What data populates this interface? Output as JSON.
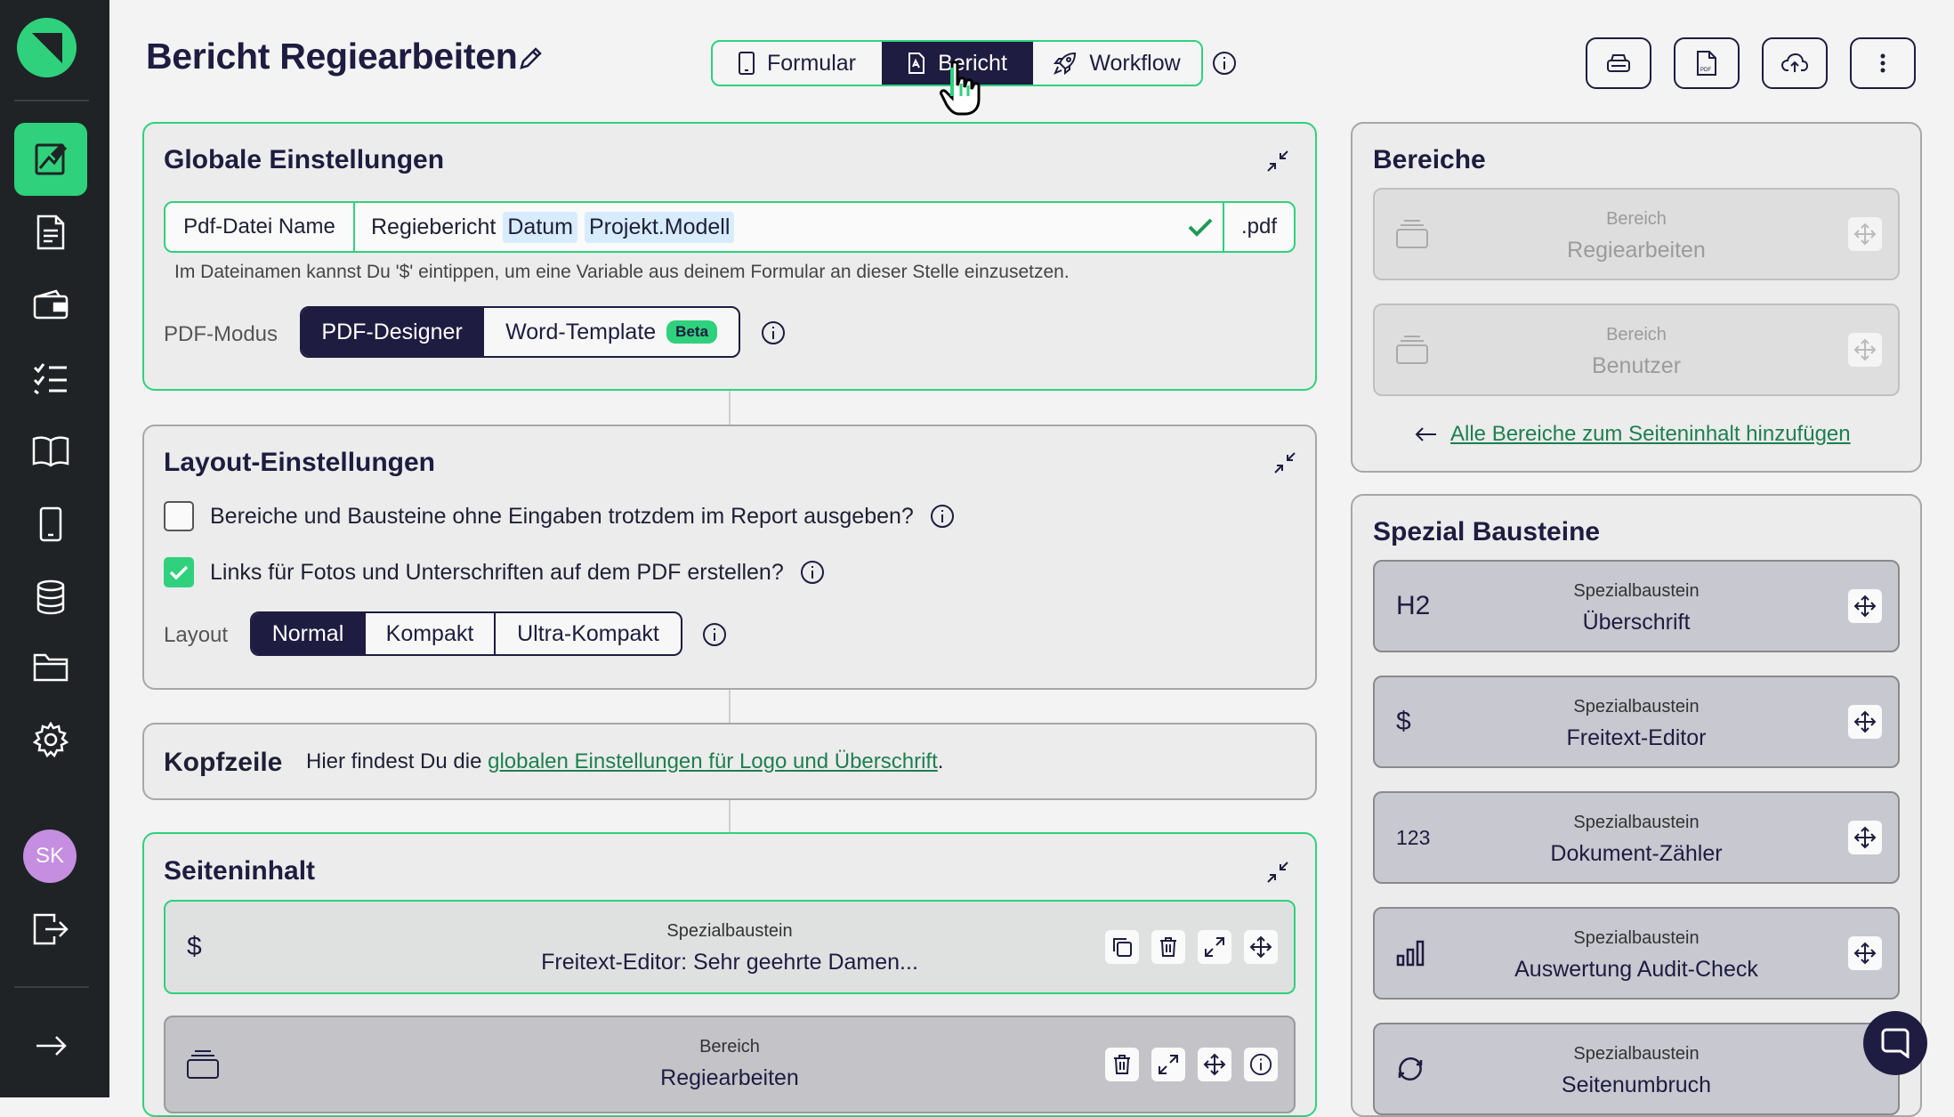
{
  "page": {
    "title": "Bericht Regiearbeiten"
  },
  "user": {
    "initials": "SK"
  },
  "sidebar": {
    "items": [
      {
        "icon": "report-designer-icon",
        "active": true
      },
      {
        "icon": "document-icon"
      },
      {
        "icon": "wallet-icon"
      },
      {
        "icon": "checklist-icon"
      },
      {
        "icon": "book-icon"
      },
      {
        "icon": "mobile-icon"
      },
      {
        "icon": "database-icon"
      },
      {
        "icon": "folder-icon"
      },
      {
        "icon": "settings-icon"
      }
    ],
    "logout_icon": "logout-icon",
    "expand_icon": "arrow-right-icon"
  },
  "top_tabs": [
    {
      "label": "Formular",
      "icon": "mobile-icon"
    },
    {
      "label": "Bericht",
      "icon": "pdf-icon",
      "active": true
    },
    {
      "label": "Workflow",
      "icon": "rocket-icon"
    }
  ],
  "toolbar_icons": [
    "printer-icon",
    "pdf-file-icon",
    "cloud-upload-icon",
    "more-vertical-icon"
  ],
  "global": {
    "title": "Globale Einstellungen",
    "filename_label": "Pdf-Datei Name",
    "filename_text": "Regiebericht",
    "filename_chips": [
      "Datum",
      "Projekt.Modell"
    ],
    "filename_suffix": ".pdf",
    "hint": "Im Dateinamen kannst Du '$' eintippen, um eine Variable aus deinem Formular an dieser Stelle einzusetzen.",
    "pdf_mode_label": "PDF-Modus",
    "pdf_modes": [
      "PDF-Designer",
      "Word-Template"
    ],
    "pdf_mode_selected": "PDF-Designer",
    "beta_badge": "Beta"
  },
  "layout": {
    "title": "Layout-Einstellungen",
    "checkbox_1": {
      "label": "Bereiche und Bausteine ohne Eingaben trotzdem im Report ausgeben?",
      "checked": false
    },
    "checkbox_2": {
      "label": "Links für Fotos und Unterschriften auf dem PDF erstellen?",
      "checked": true
    },
    "layout_label": "Layout",
    "options": [
      "Normal",
      "Kompakt",
      "Ultra-Kompakt"
    ],
    "selected": "Normal"
  },
  "header": {
    "title": "Kopfzeile",
    "text_before": "Hier findest Du die ",
    "link": "globalen Einstellungen für Logo und Überschrift",
    "text_after": "."
  },
  "content": {
    "title": "Seiteninhalt",
    "items": [
      {
        "category": "Spezialbaustein",
        "name": "Freitext-Editor: Sehr geehrte Damen...",
        "lead": "$"
      },
      {
        "category": "Bereich",
        "name": "Regiearbeiten",
        "lead_icon": "stack-icon"
      }
    ]
  },
  "areas": {
    "title": "Bereiche",
    "items": [
      {
        "category": "Bereich",
        "name": "Regiearbeiten"
      },
      {
        "category": "Bereich",
        "name": "Benutzer"
      }
    ],
    "add_all_link": "Alle Bereiche zum Seiteninhalt hinzufügen"
  },
  "special": {
    "title": "Spezial Bausteine",
    "items": [
      {
        "lead": "H2",
        "category": "Spezialbaustein",
        "name": "Überschrift"
      },
      {
        "lead": "$",
        "category": "Spezialbaustein",
        "name": "Freitext-Editor"
      },
      {
        "lead": "123",
        "category": "Spezialbaustein",
        "name": "Dokument-Zähler"
      },
      {
        "lead_icon": "bar-chart-icon",
        "category": "Spezialbaustein",
        "name": "Auswertung Audit-Check"
      },
      {
        "lead_icon": "refresh-icon",
        "category": "Spezialbaustein",
        "name": "Seitenumbruch"
      }
    ]
  },
  "colors": {
    "accent": "#2fd17c",
    "navy": "#1e1c40",
    "sidebar": "#1f2326",
    "avatar": "#c58ee0"
  }
}
